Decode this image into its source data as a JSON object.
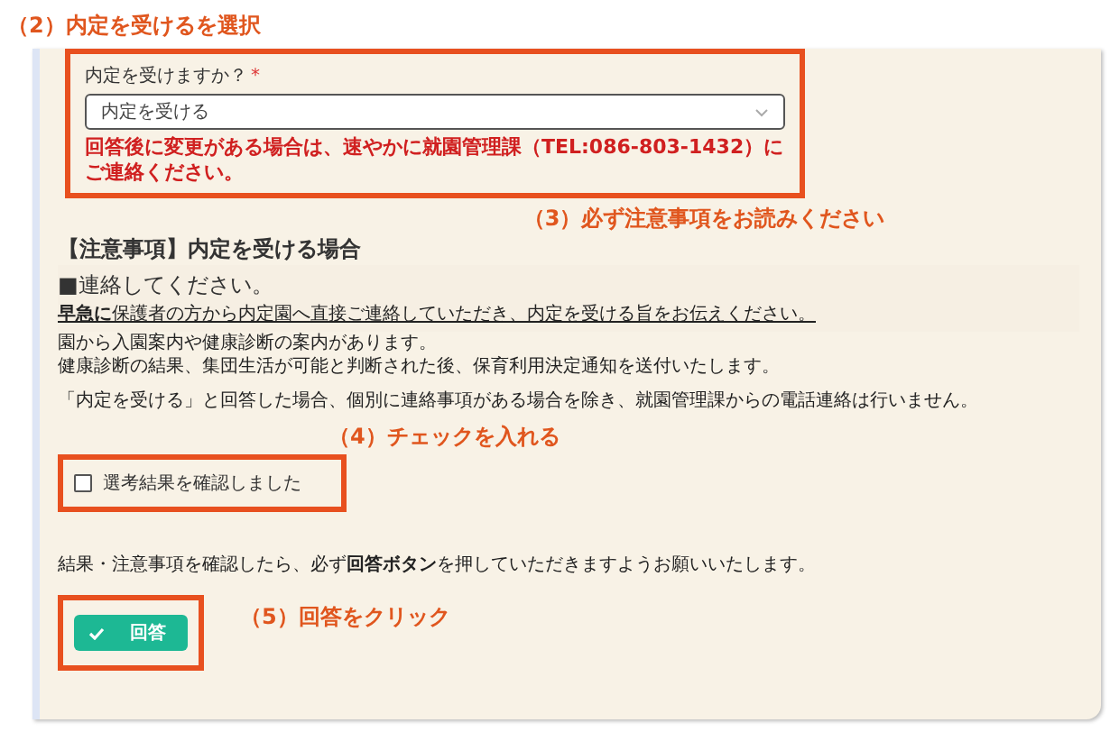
{
  "steps": [
    "（2）内定を受けるを選択",
    "（3）必ず注意事項をお読みください",
    "（4）チェックを入れる",
    "（5）回答をクリック"
  ],
  "question": {
    "label": "内定を受けますか？",
    "required": "*",
    "value": "内定を受ける",
    "warning": "回答後に変更がある場合は、速やかに就園管理課（TEL:086-803-1432）にご連絡ください。"
  },
  "notice": {
    "heading": "【注意事項】内定を受ける場合",
    "contact_title": "■連絡してください。",
    "contact_text": "**早急に**保護者の方から内定園へ直接ご連絡していただき、内定を受ける旨をお伝えください。",
    "paragraphs": [
      "園から入園案内や健康診断の案内があります。",
      "健康診断の結果、集団生活が可能と判断された後、保育利用決定通知を送付いたします。",
      "「内定を受ける」と回答した場合、個別に連絡事項がある場合を除き、就園管理課からの電話連絡は行いません。"
    ]
  },
  "confirm": {
    "label": "選考結果を確認しました",
    "checked": false
  },
  "final_note": "結果・注意事項を確認したら、必ず**回答ボタン**を押していただきますようお願いいたします。",
  "submit": {
    "label": "回答"
  }
}
